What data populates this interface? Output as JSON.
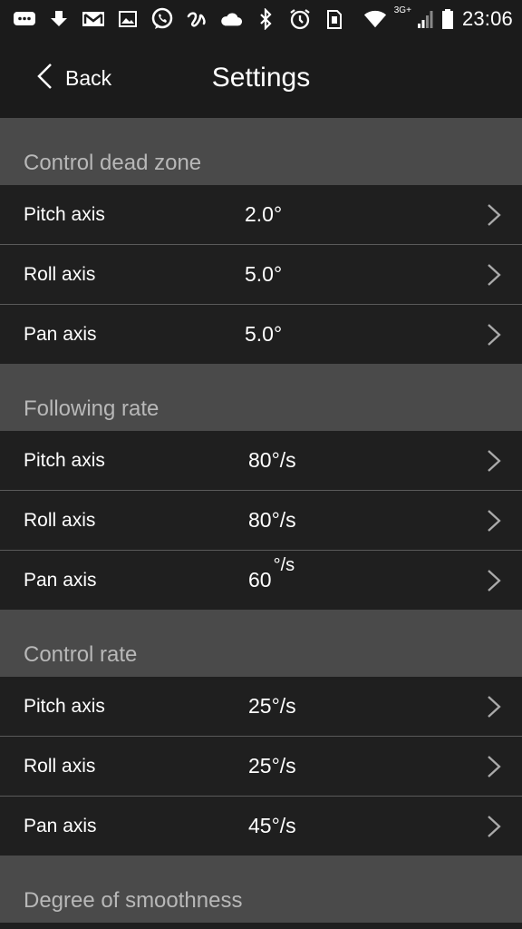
{
  "status_bar": {
    "time": "23:06",
    "network": "3G+",
    "icons": [
      "chat-icon",
      "download-icon",
      "gmail-icon",
      "image-icon",
      "whatsapp-icon",
      "swift-icon",
      "cloud-icon",
      "bluetooth-icon",
      "alarm-icon",
      "sim-icon",
      "wifi-icon",
      "signal-icon",
      "battery-icon"
    ]
  },
  "header": {
    "back_label": "Back",
    "title": "Settings"
  },
  "sections": [
    {
      "title": "Control dead zone",
      "rows": [
        {
          "label": "Pitch axis",
          "value": "2.0°"
        },
        {
          "label": "Roll axis",
          "value": "5.0°"
        },
        {
          "label": "Pan axis",
          "value": "5.0°"
        }
      ]
    },
    {
      "title": "Following rate",
      "rows": [
        {
          "label": "Pitch axis",
          "value": "80°/s"
        },
        {
          "label": "Roll axis",
          "value": "80°/s"
        },
        {
          "label": "Pan axis",
          "value": "60",
          "unit": "°/s"
        }
      ]
    },
    {
      "title": "Control rate",
      "rows": [
        {
          "label": "Pitch axis",
          "value": "25°/s"
        },
        {
          "label": "Roll axis",
          "value": "25°/s"
        },
        {
          "label": "Pan axis",
          "value": "45°/s"
        }
      ]
    },
    {
      "title": "Degree of smoothness",
      "rows": []
    }
  ]
}
